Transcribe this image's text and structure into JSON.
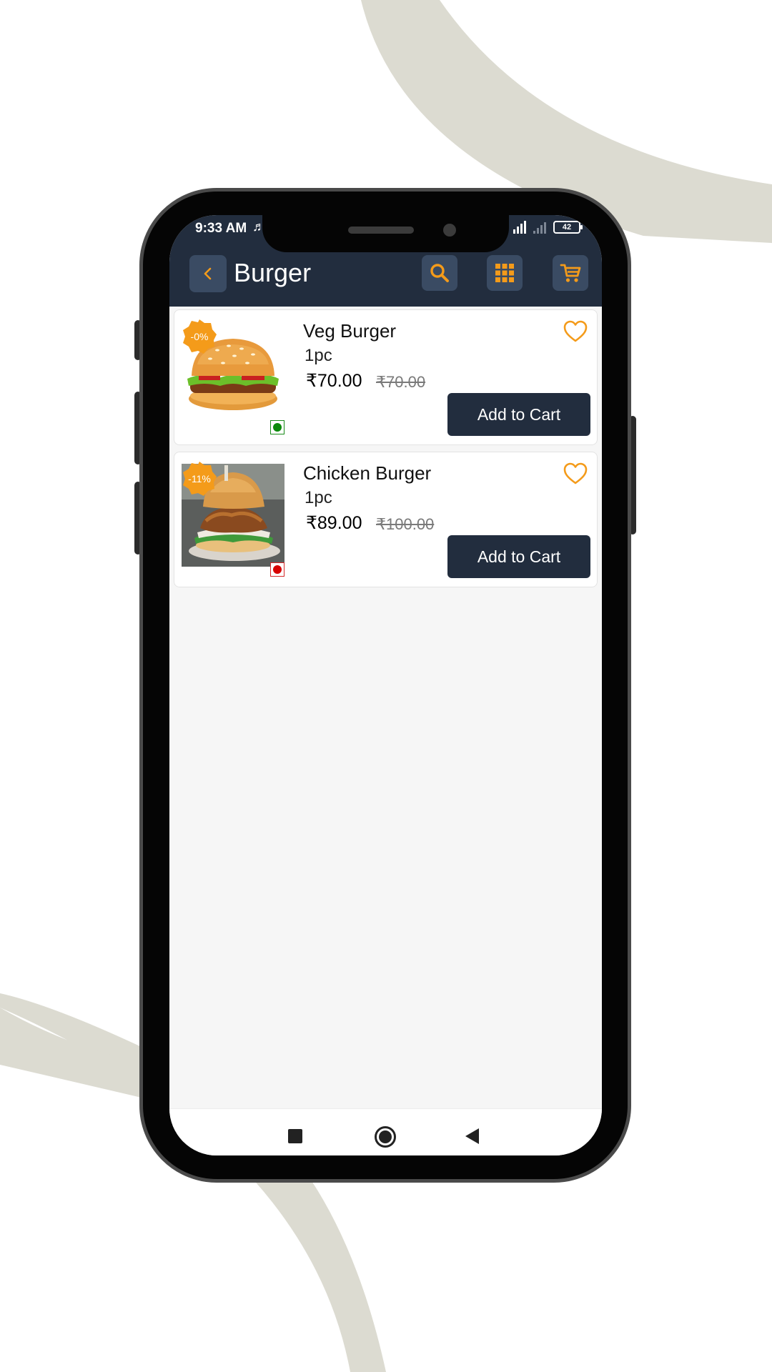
{
  "status_bar": {
    "time": "9:33 AM",
    "battery": "42"
  },
  "header": {
    "back_icon": "chevron-left-icon",
    "title": "Burger",
    "search_icon": "search-icon",
    "grid_icon": "grid-icon",
    "cart_icon": "cart-icon"
  },
  "colors": {
    "header_bg": "#222d3e",
    "accent": "#f49b1a",
    "button_bg": "#222d3e",
    "veg": "#0a8a0a",
    "non_veg": "#d70000"
  },
  "products": [
    {
      "discount": "-0%",
      "name": "Veg Burger",
      "qty": "1pc",
      "price": "₹70.00",
      "mrp": "₹70.00",
      "diet": "veg",
      "button": "Add to Cart"
    },
    {
      "discount": "-11%",
      "name": "Chicken Burger",
      "qty": "1pc",
      "price": "₹89.00",
      "mrp": "₹100.00",
      "diet": "non-veg",
      "button": "Add to Cart"
    }
  ]
}
